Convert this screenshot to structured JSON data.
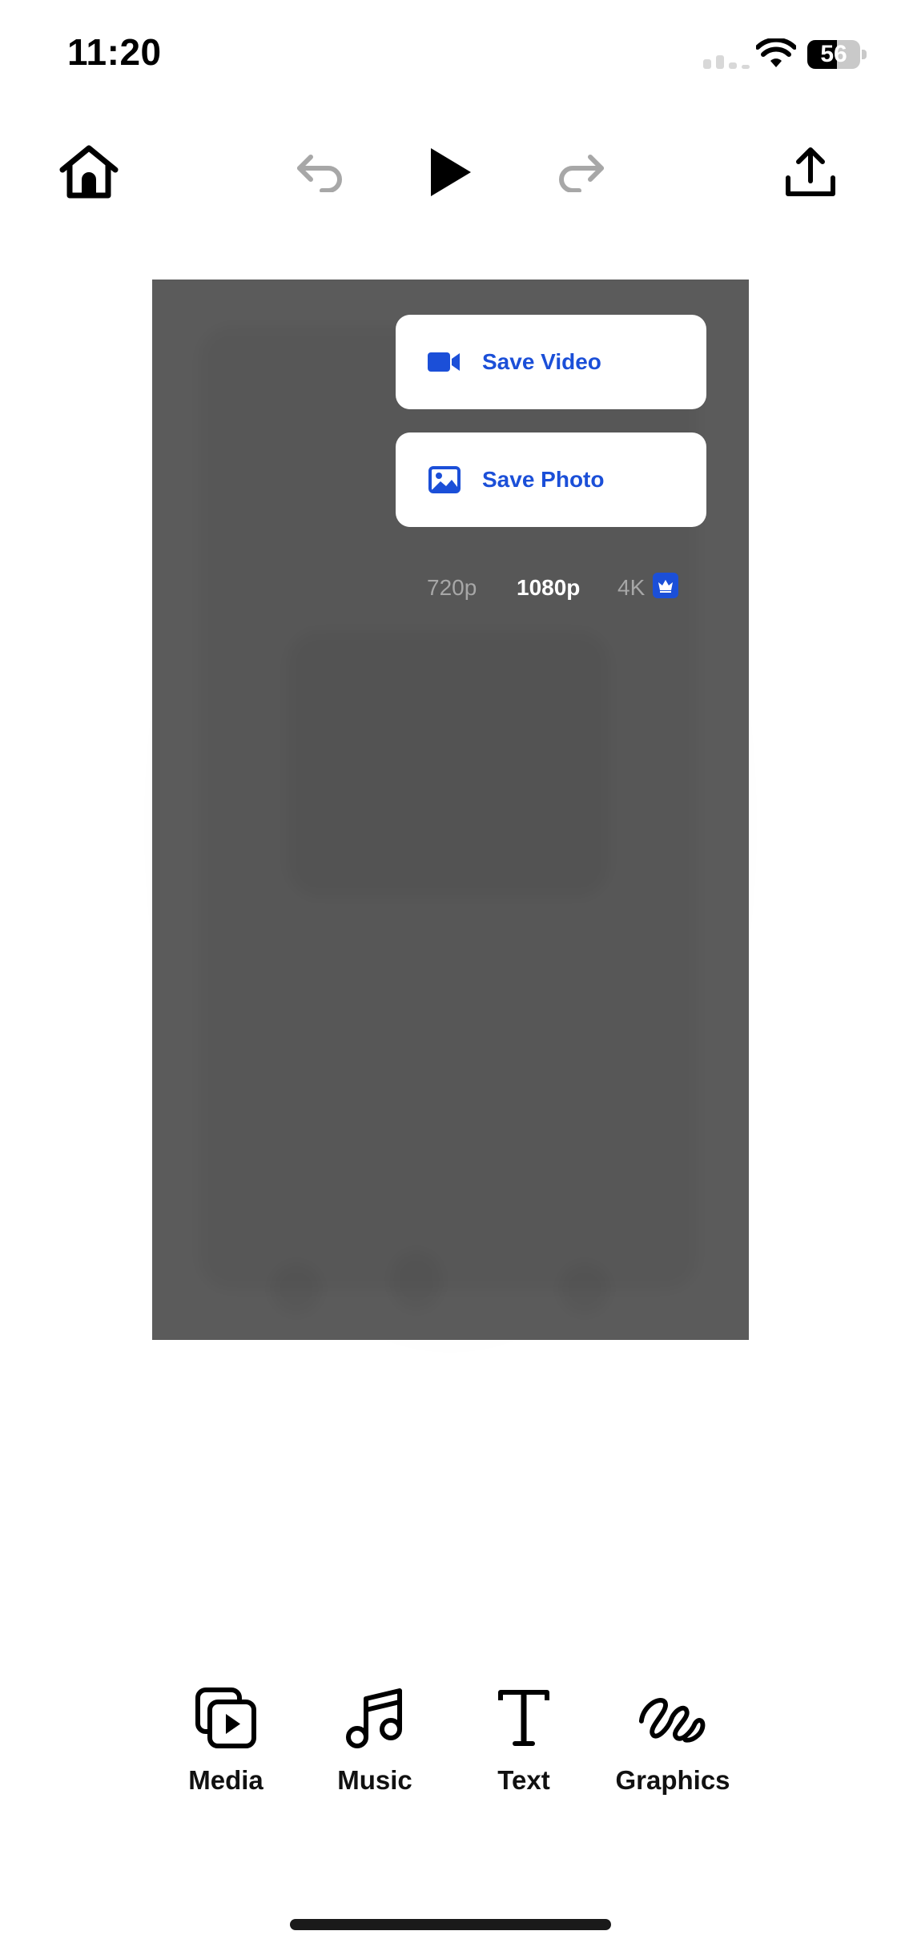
{
  "status_bar": {
    "time": "11:20",
    "battery_level": "56",
    "battery_fraction": 0.56,
    "icons": [
      "signal-icon",
      "wifi-icon",
      "battery-icon"
    ]
  },
  "toolbar": {
    "icons": [
      "home-icon",
      "undo-icon",
      "play-icon",
      "redo-icon",
      "share-icon"
    ]
  },
  "export_menu": {
    "save_video_label": "Save Video",
    "save_photo_label": "Save Photo",
    "save_video_icon": "video-camera-icon",
    "save_photo_icon": "photo-icon",
    "resolutions": [
      {
        "label": "720p",
        "selected": false,
        "premium": false
      },
      {
        "label": "1080p",
        "selected": true,
        "premium": false
      },
      {
        "label": "4K",
        "selected": false,
        "premium": true
      }
    ]
  },
  "tools": [
    {
      "label": "Media",
      "icon": "media-icon"
    },
    {
      "label": "Music",
      "icon": "music-note-icon"
    },
    {
      "label": "Text",
      "icon": "text-icon"
    },
    {
      "label": "Graphics",
      "icon": "graphics-icon"
    }
  ],
  "colors": {
    "accent": "#1b4fd8",
    "canvas_overlay": "#5b5b5b",
    "disabled": "#a7a7a7",
    "background": "#ffffff"
  }
}
